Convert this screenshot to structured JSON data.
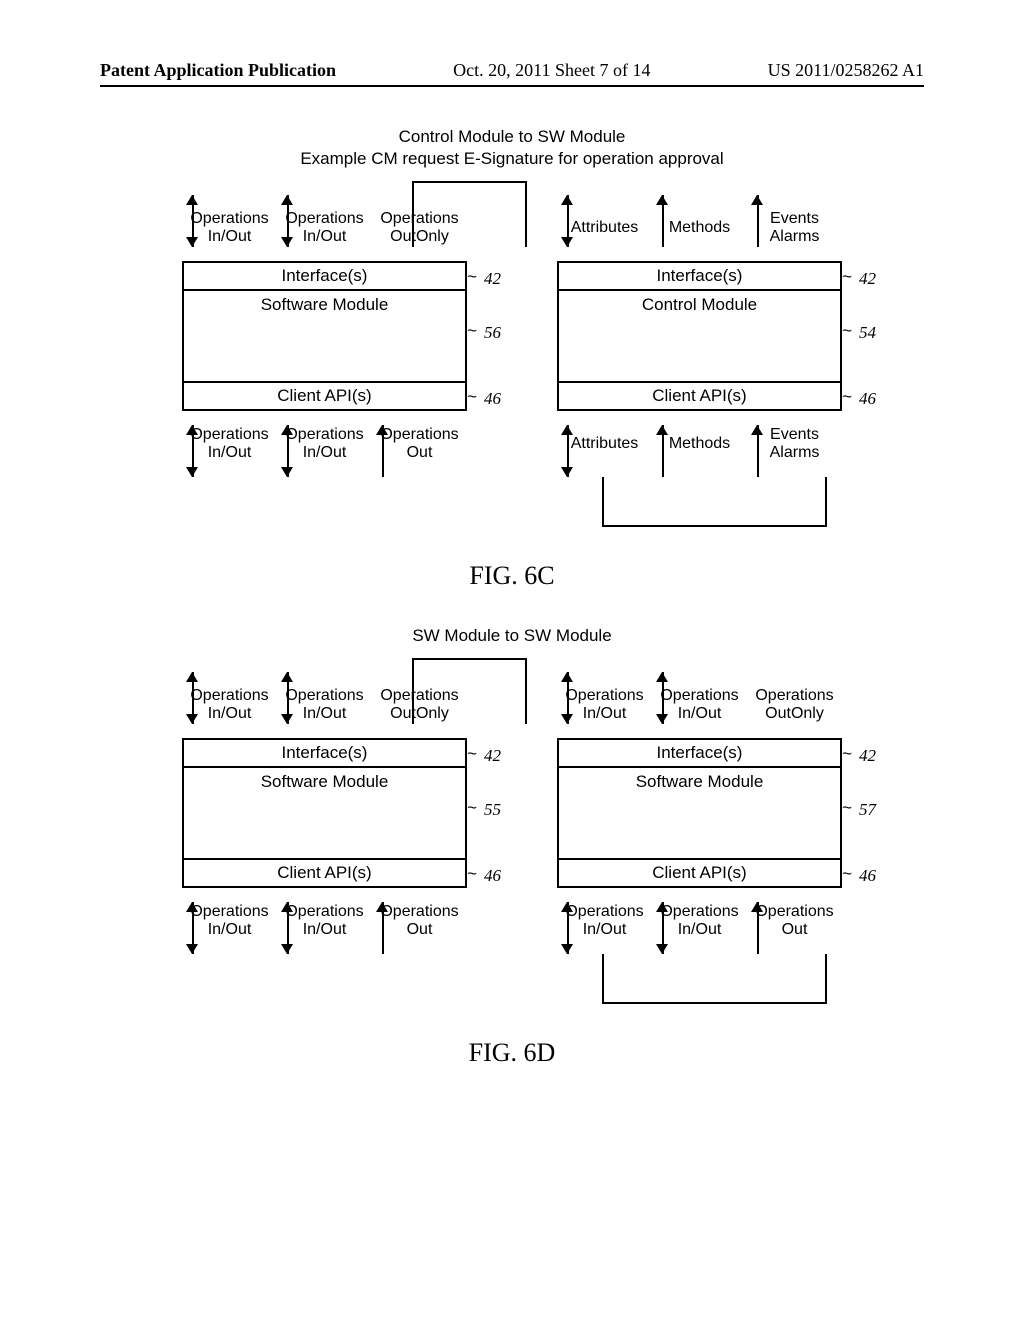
{
  "header": {
    "left": "Patent Application Publication",
    "center": "Oct. 20, 2011  Sheet 7 of 14",
    "right": "US 2011/0258262 A1"
  },
  "fig6c": {
    "title": "Control Module to SW Module",
    "subtitle": "Example CM request E-Signature for operation approval",
    "caption": "FIG. 6C",
    "left": {
      "top_ports": [
        {
          "l1": "Operations",
          "l2": "In/Out",
          "type": "bidir"
        },
        {
          "l1": "Operations",
          "l2": "In/Out",
          "type": "bidir"
        },
        {
          "l1": "Operations",
          "l2": "OutOnly",
          "type": "up"
        }
      ],
      "iface": "Interface(s)",
      "iface_ref": "42",
      "body": "Software Module",
      "body_ref": "56",
      "api": "Client API(s)",
      "api_ref": "46",
      "bottom_ports": [
        {
          "l1": "Operations",
          "l2": "In/Out",
          "type": "bidir"
        },
        {
          "l1": "Operations",
          "l2": "In/Out",
          "type": "bidir"
        },
        {
          "l1": "Operations",
          "l2": "Out",
          "type": "up"
        }
      ]
    },
    "right": {
      "top_ports": [
        {
          "l1": "Attributes",
          "l2": "",
          "type": "bidir"
        },
        {
          "l1": "Methods",
          "l2": "",
          "type": "up"
        },
        {
          "l1": "Events",
          "l2": "Alarms",
          "type": "up"
        }
      ],
      "iface": "Interface(s)",
      "iface_ref": "42",
      "body": "Control Module",
      "body_ref": "54",
      "api": "Client API(s)",
      "api_ref": "46",
      "bottom_ports": [
        {
          "l1": "Attributes",
          "l2": "",
          "type": "bidir"
        },
        {
          "l1": "Methods",
          "l2": "",
          "type": "up"
        },
        {
          "l1": "Events",
          "l2": "Alarms",
          "type": "up"
        }
      ]
    }
  },
  "fig6d": {
    "title": "SW Module to SW Module",
    "caption": "FIG. 6D",
    "left": {
      "top_ports": [
        {
          "l1": "Operations",
          "l2": "In/Out",
          "type": "bidir"
        },
        {
          "l1": "Operations",
          "l2": "In/Out",
          "type": "bidir"
        },
        {
          "l1": "Operations",
          "l2": "OutOnly",
          "type": "up"
        }
      ],
      "iface": "Interface(s)",
      "iface_ref": "42",
      "body": "Software Module",
      "body_ref": "55",
      "api": "Client API(s)",
      "api_ref": "46",
      "bottom_ports": [
        {
          "l1": "Operations",
          "l2": "In/Out",
          "type": "bidir"
        },
        {
          "l1": "Operations",
          "l2": "In/Out",
          "type": "bidir"
        },
        {
          "l1": "Operations",
          "l2": "Out",
          "type": "up"
        }
      ]
    },
    "right": {
      "top_ports": [
        {
          "l1": "Operations",
          "l2": "In/Out",
          "type": "bidir"
        },
        {
          "l1": "Operations",
          "l2": "In/Out",
          "type": "bidir"
        },
        {
          "l1": "Operations",
          "l2": "OutOnly",
          "type": "up"
        }
      ],
      "iface": "Interface(s)",
      "iface_ref": "42",
      "body": "Software Module",
      "body_ref": "57",
      "api": "Client API(s)",
      "api_ref": "46",
      "bottom_ports": [
        {
          "l1": "Operations",
          "l2": "In/Out",
          "type": "bidir"
        },
        {
          "l1": "Operations",
          "l2": "In/Out",
          "type": "bidir"
        },
        {
          "l1": "Operations",
          "l2": "Out",
          "type": "up"
        }
      ]
    }
  }
}
